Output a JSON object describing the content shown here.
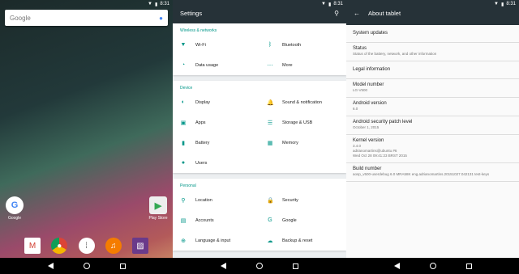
{
  "statusbar": {
    "time": "8:31",
    "wifi_icon": "wifi-icon",
    "battery_icon": "battery-icon"
  },
  "home": {
    "search_logo": "Google",
    "apps": [
      {
        "label": "Google",
        "icon": "G"
      },
      {
        "label": "Play Store",
        "icon": "▶"
      }
    ],
    "dock": [
      "gmail-icon",
      "chrome-icon",
      "app-drawer-icon",
      "music-icon",
      "photos-icon"
    ]
  },
  "settings": {
    "title": "Settings",
    "categories": [
      {
        "title": "Wireless & networks",
        "items": [
          {
            "label": "Wi-Fi",
            "icon": "▼"
          },
          {
            "label": "Bluetooth",
            "icon": "ᛒ"
          },
          {
            "label": "Data usage",
            "icon": "◔"
          },
          {
            "label": "More",
            "icon": "⋯"
          }
        ]
      },
      {
        "title": "Device",
        "items": [
          {
            "label": "Display",
            "icon": "◐"
          },
          {
            "label": "Sound & notification",
            "icon": "🔔"
          },
          {
            "label": "Apps",
            "icon": "▣"
          },
          {
            "label": "Storage & USB",
            "icon": "☰"
          },
          {
            "label": "Battery",
            "icon": "▮"
          },
          {
            "label": "Memory",
            "icon": "▦"
          },
          {
            "label": "Users",
            "icon": "●"
          }
        ]
      },
      {
        "title": "Personal",
        "items": [
          {
            "label": "Location",
            "icon": "⚲"
          },
          {
            "label": "Security",
            "icon": "🔒"
          },
          {
            "label": "Accounts",
            "icon": "▤"
          },
          {
            "label": "Google",
            "icon": "G"
          },
          {
            "label": "Language & input",
            "icon": "⊕"
          },
          {
            "label": "Backup & reset",
            "icon": "☁"
          }
        ]
      }
    ]
  },
  "about": {
    "title": "About tablet",
    "items": [
      {
        "title": "System updates",
        "sub": ""
      },
      {
        "title": "Status",
        "sub": "Status of the battery, network, and other information"
      },
      {
        "title": "Legal information",
        "sub": ""
      },
      {
        "title": "Model number",
        "sub": "LG-V500"
      },
      {
        "title": "Android version",
        "sub": "6.0"
      },
      {
        "title": "Android security patch level",
        "sub": "October 1, 2015"
      },
      {
        "title": "Kernel version",
        "sub": "3.4.0\nadrianomartins@ubuntu #6\nWed Oct 28 09:41:23 BRST 2015"
      },
      {
        "title": "Build number",
        "sub": "aosp_v500-userdebug 6.0 MRA58K eng.adrianomartins.20151027.042131 test-keys"
      }
    ]
  }
}
